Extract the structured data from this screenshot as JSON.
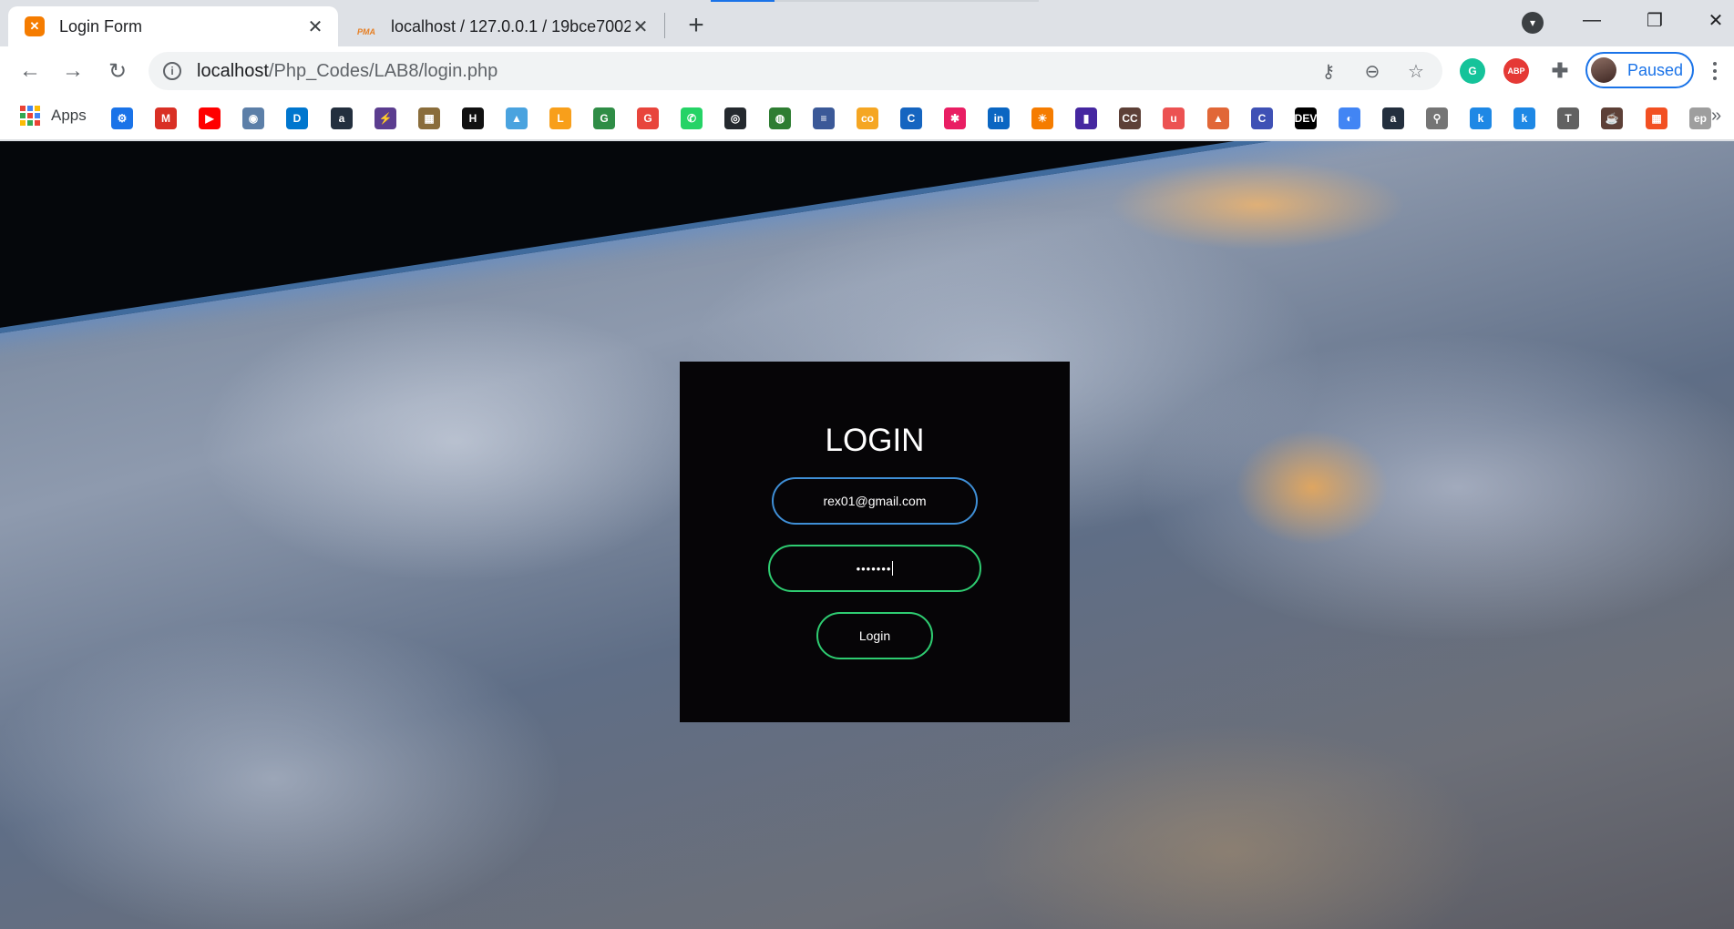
{
  "tabs": [
    {
      "title": "Login Form",
      "favicon": "xampp-icon",
      "active": true
    },
    {
      "title": "localhost / 127.0.0.1 / 19bce7002",
      "favicon": "pma-icon",
      "favicon_text": "PMA",
      "active": false
    }
  ],
  "address_bar": {
    "host": "localhost",
    "path": "/Php_Codes/LAB8/login.php"
  },
  "profile": {
    "label": "Paused"
  },
  "bookmarks": {
    "apps_label": "Apps",
    "items": [
      {
        "name": "settings-icon",
        "text": "⚙",
        "color": "#1a73e8"
      },
      {
        "name": "gmail-icon",
        "text": "M",
        "color": "#d93025"
      },
      {
        "name": "youtube-icon",
        "text": "▶",
        "color": "#ff0000"
      },
      {
        "name": "vit-icon",
        "text": "◉",
        "color": "#5c7fa8"
      },
      {
        "name": "dell-icon",
        "text": "D",
        "color": "#0076ce"
      },
      {
        "name": "amazon-icon",
        "text": "a",
        "color": "#232f3e"
      },
      {
        "name": "bolt-icon",
        "text": "⚡",
        "color": "#5b3d8f"
      },
      {
        "name": "image-icon",
        "text": "▦",
        "color": "#8a6d3b"
      },
      {
        "name": "hackerearth-icon",
        "text": "H",
        "color": "#111111"
      },
      {
        "name": "pyramid-icon",
        "text": "▲",
        "color": "#4aa3df"
      },
      {
        "name": "leetcode-icon",
        "text": "L",
        "color": "#f89f1b"
      },
      {
        "name": "geeksforgeeks-icon",
        "text": "G",
        "color": "#2f8d46"
      },
      {
        "name": "grammarly-g-icon",
        "text": "G",
        "color": "#e8453c"
      },
      {
        "name": "whatsapp-icon",
        "text": "✆",
        "color": "#25d366"
      },
      {
        "name": "github-icon",
        "text": "◎",
        "color": "#24292e"
      },
      {
        "name": "coursera-icon",
        "text": "◍",
        "color": "#2e7d32"
      },
      {
        "name": "stack-icon",
        "text": "≡",
        "color": "#3b5998"
      },
      {
        "name": "co-icon",
        "text": "co",
        "color": "#f5a623"
      },
      {
        "name": "codechef-c-icon",
        "text": "C",
        "color": "#1565c0"
      },
      {
        "name": "asterisk-icon",
        "text": "✱",
        "color": "#e91e63"
      },
      {
        "name": "linkedin-icon",
        "text": "in",
        "color": "#0a66c2"
      },
      {
        "name": "sun-icon",
        "text": "☀",
        "color": "#f57c00"
      },
      {
        "name": "chart-icon",
        "text": "▮",
        "color": "#4527a0"
      },
      {
        "name": "cc-icon",
        "text": "CC",
        "color": "#5d4037"
      },
      {
        "name": "udemy-icon",
        "text": "u",
        "color": "#ec5252"
      },
      {
        "name": "matlab-icon",
        "text": "▲",
        "color": "#e16737"
      },
      {
        "name": "codechef-icon",
        "text": "C",
        "color": "#3f51b5"
      },
      {
        "name": "dev-icon",
        "text": "DEV",
        "color": "#000000"
      },
      {
        "name": "google-meet-icon",
        "text": "◐",
        "color": "#4285f4"
      },
      {
        "name": "amazon-2-icon",
        "text": "a",
        "color": "#232f3e"
      },
      {
        "name": "search-icon",
        "text": "⚲",
        "color": "#757575"
      },
      {
        "name": "k-icon",
        "text": "k",
        "color": "#1e88e5"
      },
      {
        "name": "k-2-icon",
        "text": "k",
        "color": "#1e88e5"
      },
      {
        "name": "t-icon",
        "text": "T",
        "color": "#616161"
      },
      {
        "name": "java-icon",
        "text": "☕",
        "color": "#5d4037"
      },
      {
        "name": "microsoft-icon",
        "text": "▦",
        "color": "#f25022"
      },
      {
        "name": "ep-icon",
        "text": "ep",
        "color": "#9e9e9e"
      }
    ]
  },
  "login": {
    "heading": "LOGIN",
    "email_value": "rex01@gmail.com",
    "password_mask": "•••••••",
    "button_label": "Login"
  },
  "colors": {
    "email_border": "#3f8fd6",
    "password_border": "#2ecc71",
    "button_border": "#2ecc71",
    "card_background": "#060507"
  }
}
